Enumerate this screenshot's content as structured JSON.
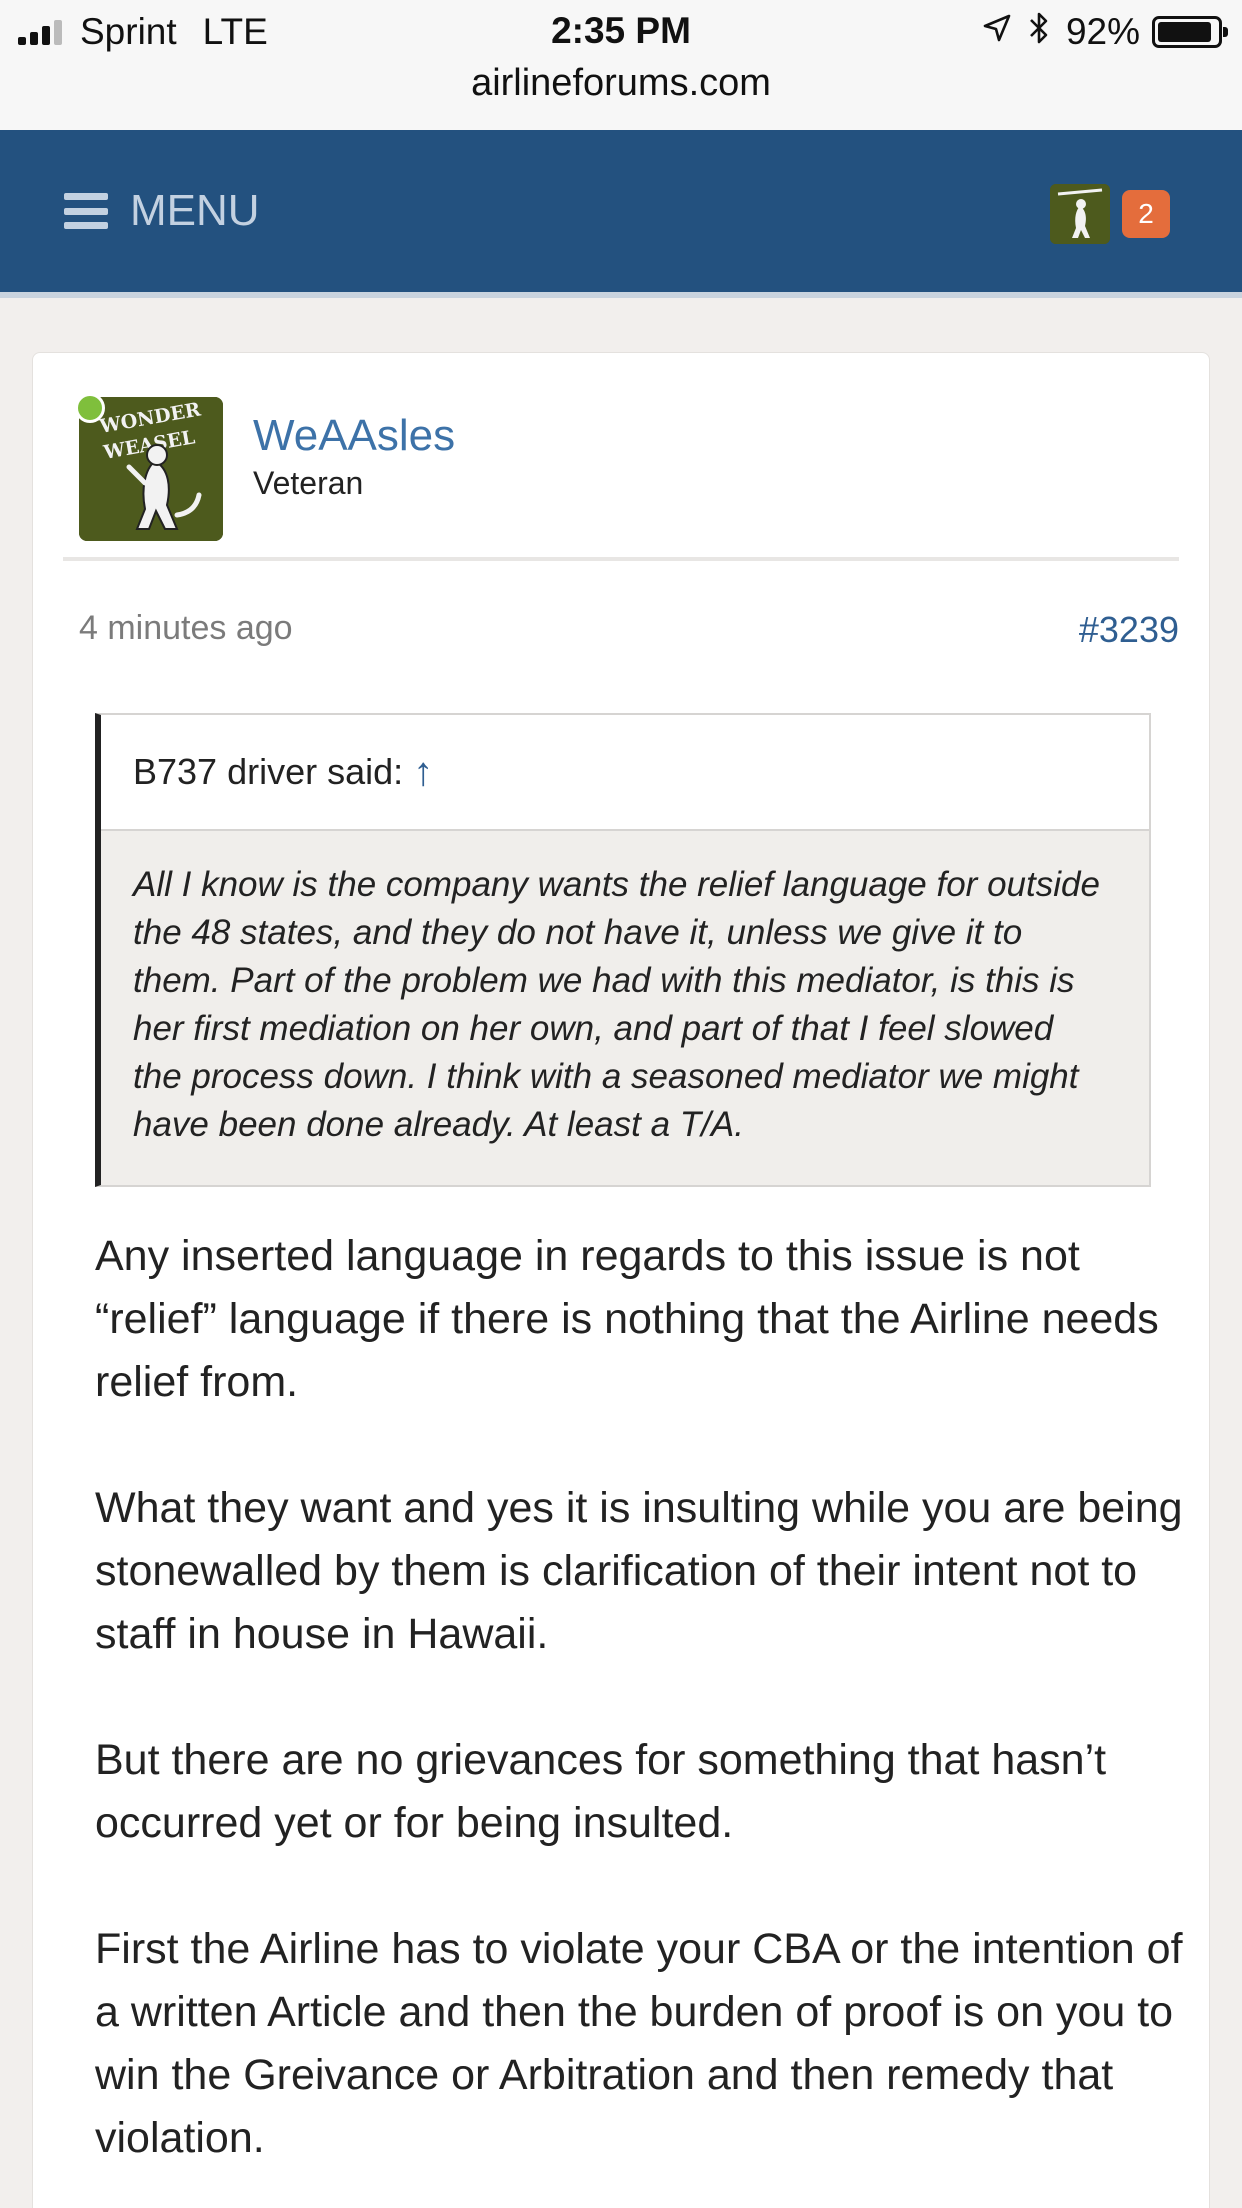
{
  "status_bar": {
    "carrier": "Sprint",
    "network": "LTE",
    "time": "2:35 PM",
    "battery_percent": "92%",
    "url": "airlineforums.com"
  },
  "nav": {
    "menu_label": "MENU",
    "notification_count": "2",
    "colors": {
      "bar": "#23517f",
      "badge": "#e46d3c"
    }
  },
  "post": {
    "author": {
      "name": "WeAAsles",
      "title": "Veteran",
      "avatar_text": "WONDER WEASEL",
      "online": true
    },
    "time": "4 minutes ago",
    "number": "#3239",
    "quote": {
      "attribution": "B737 driver said:",
      "arrow": "↑",
      "text": "All I know is the company wants the relief language for outside the 48 states, and they do not have it, unless we give it to them. Part of the problem we had with this mediator, is this is her first mediation on her own, and part of that I feel slowed the process down. I think with a seasoned mediator we might have been done already. At least a T/A."
    },
    "paragraphs": [
      "Any inserted language in regards to this issue is not “relief” language if there is nothing that the Airline needs relief from.",
      "What they want and yes it is insulting while you are being stonewalled by them is clarification of their intent not to staff in house in Hawaii.",
      "But there are no grievances for something that hasn’t occurred yet or for being insulted.",
      "First the Airline has to violate your CBA or the intention of a written Article and then the burden of proof is on you to win the Greivance or Arbitration and then remedy that violation."
    ]
  }
}
